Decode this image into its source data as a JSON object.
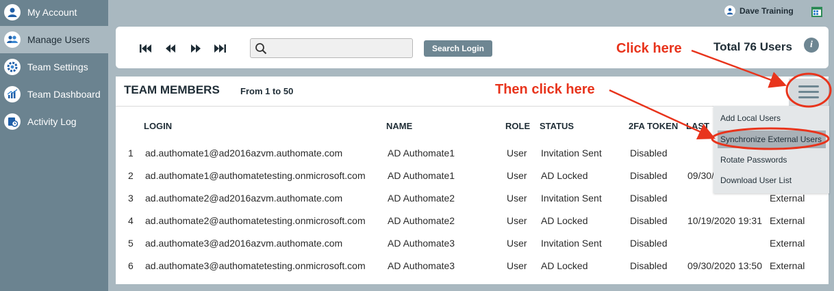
{
  "sidebar": {
    "items": [
      {
        "label": "My Account",
        "icon": "user-icon",
        "active": false
      },
      {
        "label": "Manage Users",
        "icon": "users-icon",
        "active": true
      },
      {
        "label": "Team Settings",
        "icon": "gear-icon",
        "active": false
      },
      {
        "label": "Team Dashboard",
        "icon": "chart-icon",
        "active": false
      },
      {
        "label": "Activity Log",
        "icon": "activity-log-icon",
        "active": false
      }
    ]
  },
  "header": {
    "user_name": "Dave Training"
  },
  "toolbar": {
    "search_placeholder": "",
    "search_value": "",
    "search_button": "Search Login",
    "total_label": "Total 76 Users"
  },
  "card": {
    "title": "TEAM MEMBERS",
    "range": "From 1 to 50"
  },
  "table": {
    "columns": [
      "LOGIN",
      "NAME",
      "ROLE",
      "STATUS",
      "2FA TOKEN",
      "LAST"
    ],
    "rows": [
      {
        "num": "1",
        "login": "ad.authomate1@ad2016azvm.authomate.com",
        "name": "AD Authomate1",
        "role": "User",
        "status": "Invitation Sent",
        "twofa": "Disabled",
        "last": "",
        "type": ""
      },
      {
        "num": "2",
        "login": "ad.authomate1@authomatetesting.onmicrosoft.com",
        "name": "AD Authomate1",
        "role": "User",
        "status": "AD Locked",
        "twofa": "Disabled",
        "last": "09/30/",
        "type": ""
      },
      {
        "num": "3",
        "login": "ad.authomate2@ad2016azvm.authomate.com",
        "name": "AD Authomate2",
        "role": "User",
        "status": "Invitation Sent",
        "twofa": "Disabled",
        "last": "",
        "type": "External"
      },
      {
        "num": "4",
        "login": "ad.authomate2@authomatetesting.onmicrosoft.com",
        "name": "AD Authomate2",
        "role": "User",
        "status": "AD Locked",
        "twofa": "Disabled",
        "last": "10/19/2020 19:31",
        "type": "External"
      },
      {
        "num": "5",
        "login": "ad.authomate3@ad2016azvm.authomate.com",
        "name": "AD Authomate3",
        "role": "User",
        "status": "Invitation Sent",
        "twofa": "Disabled",
        "last": "",
        "type": "External"
      },
      {
        "num": "6",
        "login": "ad.authomate3@authomatetesting.onmicrosoft.com",
        "name": "AD Authomate3",
        "role": "User",
        "status": "AD Locked",
        "twofa": "Disabled",
        "last": "09/30/2020 13:50",
        "type": "External"
      }
    ]
  },
  "menu": {
    "items": [
      "Add Local Users",
      "Synchronize External Users",
      "Rotate Passwords",
      "Download User List"
    ],
    "highlighted": "Synchronize External Users"
  },
  "annotations": {
    "click_here": "Click here",
    "then_click_here": "Then click here",
    "color": "#e8341c"
  }
}
